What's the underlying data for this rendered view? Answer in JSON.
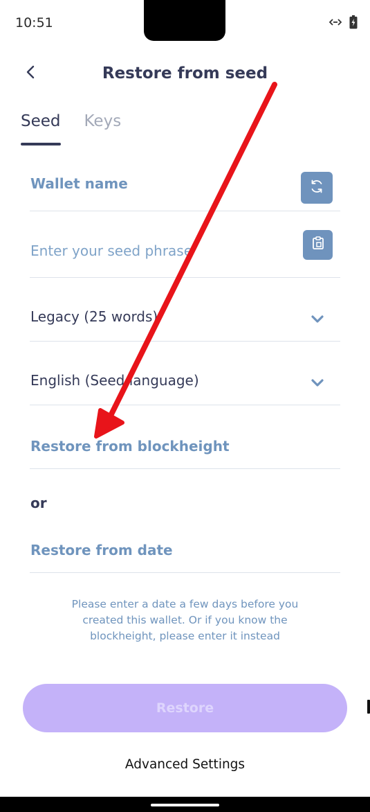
{
  "status_bar": {
    "time": "10:51"
  },
  "header": {
    "title": "Restore from seed"
  },
  "tabs": [
    {
      "label": "Seed",
      "active": true
    },
    {
      "label": "Keys",
      "active": false
    }
  ],
  "form": {
    "wallet_name": {
      "label": "Wallet name"
    },
    "seed_phrase": {
      "placeholder": "Enter your seed phrase"
    },
    "seed_type": {
      "value": "Legacy (25 words)"
    },
    "seed_language": {
      "value": "English (Seed language)"
    },
    "blockheight": {
      "label": "Restore from blockheight"
    },
    "or_text": "or",
    "restore_date": {
      "label": "Restore from date"
    }
  },
  "help_text": [
    "Please enter a date a few days before you",
    "created this wallet. Or if you know the",
    "blockheight, please enter it instead"
  ],
  "buttons": {
    "restore": "Restore",
    "advanced_settings": "Advanced Settings"
  },
  "colors": {
    "primary_text": "#353a58",
    "accent_blue": "#6f93bd",
    "restore_button_disabled": "#c4b2f9",
    "annotation_arrow": "#e8141a"
  },
  "icons": {
    "back": "chevron-left-icon",
    "regenerate_name": "refresh-icon",
    "paste": "clipboard-icon",
    "dropdown": "chevron-down-icon"
  }
}
